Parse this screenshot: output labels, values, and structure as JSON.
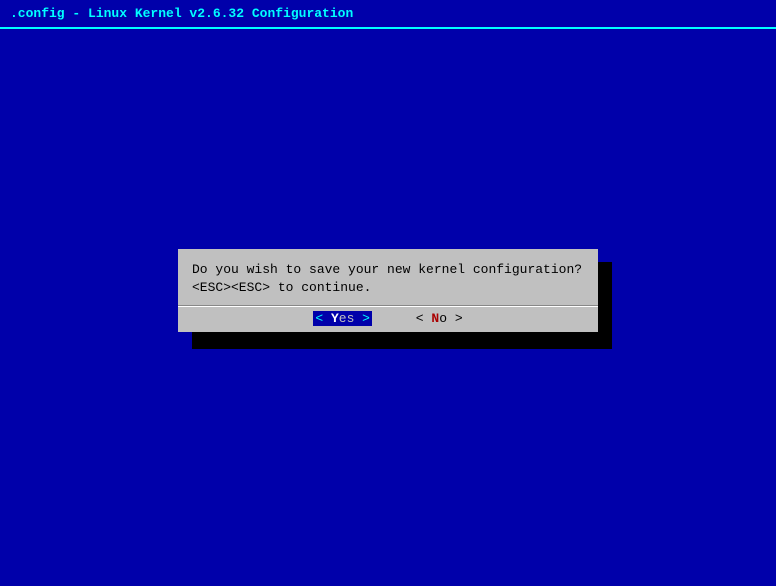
{
  "title": ".config - Linux Kernel v2.6.32 Configuration",
  "dialog": {
    "line1": "Do you wish to save your new kernel configuration?",
    "line2": "<ESC><ESC> to continue.",
    "yes": {
      "left_bracket": "<",
      "pre": " ",
      "hotkey": "Y",
      "post": "es ",
      "right_bracket": ">"
    },
    "no": {
      "left_bracket": "<",
      "pre": "  ",
      "hotkey": "N",
      "post": "o  ",
      "right_bracket": ">"
    }
  }
}
